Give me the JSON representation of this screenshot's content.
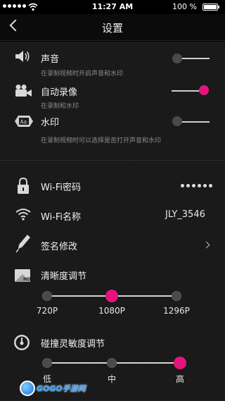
{
  "status_bar": {
    "time": "11:27 AM",
    "battery_text": "100 %",
    "battery_level": 1.0
  },
  "nav": {
    "title": "设置",
    "back_icon": "chevron-left-icon"
  },
  "settings": {
    "sound": {
      "label": "声音",
      "sub": "在录制视频时开启声音和水印",
      "enabled": false,
      "icon": "speaker-icon"
    },
    "auto_record": {
      "label": "自动录像",
      "sub": "在录制和水印",
      "enabled": true,
      "icon": "video-camera-icon"
    },
    "watermark": {
      "label": "水印",
      "sub": "在录制视频时可以选择是否打开声音和水印",
      "enabled": false,
      "icon": "watermark-icon"
    },
    "wifi_password": {
      "label": "Wi-Fi密码",
      "value_masked": "••••••",
      "icon": "lock-icon"
    },
    "wifi_name": {
      "label": "Wi-Fi名称",
      "value": "JLY_3546",
      "icon": "wifi-icon"
    },
    "signature": {
      "label": "签名修改",
      "icon": "pen-icon"
    },
    "resolution": {
      "label": "清晰度调节",
      "options": [
        "720P",
        "1080P",
        "1296P"
      ],
      "selected_index": 1,
      "icon": "hd-icon"
    },
    "sensitivity": {
      "label": "碰撞灵敏度调节",
      "options": [
        "低",
        "中",
        "高"
      ],
      "selected_index": 2,
      "icon": "gauge-icon"
    }
  },
  "watermark_logo": "GOGO手游网",
  "colors": {
    "accent": "#e5147d",
    "knob_off": "#4a4a4a",
    "background": "#1c1c1c",
    "subtext": "#8c8c8c"
  }
}
